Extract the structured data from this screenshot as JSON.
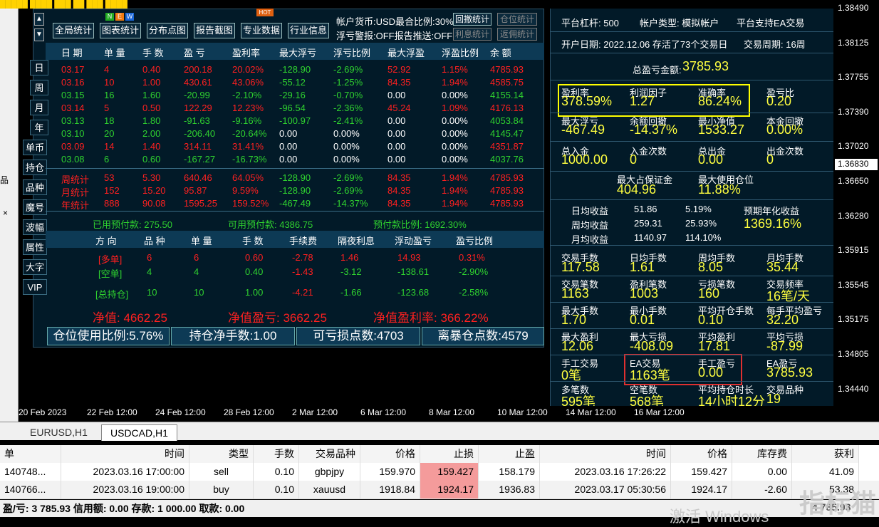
{
  "topbar": {
    "text": "█████ ████ ███ ██ ███ ████"
  },
  "left_strip": {
    "items": [
      "品",
      "×"
    ]
  },
  "price_axis": {
    "ticks": [
      "1.38490",
      "1.38125",
      "1.37755",
      "1.37390",
      "1.37020",
      "1.36650",
      "1.36280",
      "1.35915",
      "1.35545",
      "1.35175",
      "1.34805",
      "1.34440"
    ],
    "current": "1.36830"
  },
  "time_axis": {
    "ticks": [
      "20 Feb 2023",
      "22 Feb 12:00",
      "24 Feb 12:00",
      "28 Feb 12:00",
      "2 Mar 12:00",
      "6 Mar 12:00",
      "8 Mar 12:00",
      "10 Mar 12:00",
      "14 Mar 12:00",
      "16 Mar 12:00"
    ]
  },
  "chart_tabs": {
    "items": [
      "EURUSD,H1",
      "USDCAD,H1"
    ],
    "active": "USDCAD,H1"
  },
  "panel": {
    "buttons": [
      "全局统计",
      "图表统计",
      "分布点图",
      "报告截图",
      "专业数据",
      "行业信息"
    ],
    "badges": {
      "new": [
        "N",
        "E",
        "W"
      ],
      "hot": "HOT"
    },
    "info_line1": "帐户货币:USD最合比例:30%",
    "info_line2": "浮亏警报:OFF报告推送:OFF",
    "right_buttons": [
      {
        "label": "回撤统计",
        "active": true
      },
      {
        "label": "仓位统计",
        "active": false
      },
      {
        "label": "利息统计",
        "active": false
      },
      {
        "label": "返佣统计",
        "active": false
      }
    ],
    "period_buttons": [
      "日",
      "周",
      "月",
      "年"
    ],
    "side_buttons": [
      "单币",
      "持仓",
      "品种",
      "魔号",
      "波幅",
      "属性",
      "大字",
      "VIP"
    ],
    "columns": [
      "日 期",
      "单 量",
      "手 数",
      "盈 亏",
      "盈利率",
      "最大浮亏",
      "浮亏比例",
      "最大浮盈",
      "浮盈比例",
      "余 额"
    ],
    "daily_rows": [
      {
        "d": "03.17",
        "n": "4",
        "lots": "0.40",
        "pl": "200.18",
        "rate": "20.02%",
        "mfl": "-128.90",
        "mflr": "-2.69%",
        "mfp": "52.92",
        "mfpr": "1.15%",
        "bal": "4785.93",
        "color": "red"
      },
      {
        "d": "03.16",
        "n": "10",
        "lots": "1.00",
        "pl": "430.61",
        "rate": "43.06%",
        "mfl": "-55.12",
        "mflr": "-1.25%",
        "mfp": "84.35",
        "mfpr": "1.94%",
        "bal": "4585.75",
        "color": "red"
      },
      {
        "d": "03.15",
        "n": "16",
        "lots": "1.60",
        "pl": "-20.99",
        "rate": "-2.10%",
        "mfl": "-29.16",
        "mflr": "-0.70%",
        "mfp": "0.00",
        "mfpr": "0.00%",
        "bal": "4155.14",
        "color": "green"
      },
      {
        "d": "03.14",
        "n": "5",
        "lots": "0.50",
        "pl": "122.29",
        "rate": "12.23%",
        "mfl": "-96.54",
        "mflr": "-2.36%",
        "mfp": "45.24",
        "mfpr": "1.09%",
        "bal": "4176.13",
        "color": "red"
      },
      {
        "d": "03.13",
        "n": "18",
        "lots": "1.80",
        "pl": "-91.63",
        "rate": "-9.16%",
        "mfl": "-100.97",
        "mflr": "-2.41%",
        "mfp": "0.00",
        "mfpr": "0.00%",
        "bal": "4053.84",
        "color": "green"
      },
      {
        "d": "03.10",
        "n": "20",
        "lots": "2.00",
        "pl": "-206.40",
        "rate": "-20.64%",
        "mfl": "0.00",
        "mflr": "0.00%",
        "mfp": "0.00",
        "mfpr": "0.00%",
        "bal": "4145.47",
        "color": "green"
      },
      {
        "d": "03.09",
        "n": "14",
        "lots": "1.40",
        "pl": "314.11",
        "rate": "31.41%",
        "mfl": "0.00",
        "mflr": "0.00%",
        "mfp": "0.00",
        "mfpr": "0.00%",
        "bal": "4351.87",
        "color": "red"
      },
      {
        "d": "03.08",
        "n": "6",
        "lots": "0.60",
        "pl": "-167.27",
        "rate": "-16.73%",
        "mfl": "0.00",
        "mflr": "0.00%",
        "mfp": "0.00",
        "mfpr": "0.00%",
        "bal": "4037.76",
        "color": "green"
      }
    ],
    "summary_rows": [
      {
        "d": "周统计",
        "n": "53",
        "lots": "5.30",
        "pl": "640.46",
        "rate": "64.05%",
        "mfl": "-128.90",
        "mflr": "-2.69%",
        "mfp": "84.35",
        "mfpr": "1.94%",
        "bal": "4785.93"
      },
      {
        "d": "月统计",
        "n": "152",
        "lots": "15.20",
        "pl": "95.87",
        "rate": "9.59%",
        "mfl": "-128.90",
        "mflr": "-2.69%",
        "mfp": "84.35",
        "mfpr": "1.94%",
        "bal": "4785.93"
      },
      {
        "d": "年统计",
        "n": "888",
        "lots": "90.08",
        "pl": "1595.25",
        "rate": "159.52%",
        "mfl": "-467.49",
        "mflr": "-14.37%",
        "mfp": "84.35",
        "mfpr": "1.94%",
        "bal": "4785.93"
      }
    ],
    "prepay": {
      "used": "已用预付款: 275.50",
      "avail": "可用预付款: 4386.75",
      "ratio": "预付款比例: 1692.30%"
    },
    "pos_columns": [
      "方 向",
      "品 种",
      "单 量",
      "手 数",
      "手续费",
      "隔夜利息",
      "浮动盈亏",
      "盈亏比例"
    ],
    "pos_rows": [
      {
        "dir": "[多单]",
        "sym": "6",
        "n": "6",
        "lots": "0.60",
        "fee": "-2.78",
        "swap": "1.46",
        "fl": "14.93",
        "flr": "0.31%",
        "color": "red"
      },
      {
        "dir": "[空单]",
        "sym": "4",
        "n": "4",
        "lots": "0.40",
        "fee": "-1.43",
        "swap": "-3.12",
        "fl": "-138.61",
        "flr": "-2.90%",
        "color": "green"
      },
      {
        "dir": "[总持仓]",
        "sym": "10",
        "n": "10",
        "lots": "1.00",
        "fee": "-4.21",
        "swap": "-1.66",
        "fl": "-123.68",
        "flr": "-2.58%",
        "color": "green"
      }
    ],
    "equity": {
      "nav": "净值: 4662.25",
      "nav_pl": "净值盈亏: 3662.25",
      "nav_rate": "净值盈利率: 366.22%"
    },
    "bottom_boxes": [
      "仓位使用比例:5.76%",
      "持仓净手数:1.00",
      "可亏损点数:4703",
      "离暴仓点数:4579"
    ]
  },
  "stats": {
    "leverage": "平台杠杆: 500",
    "acct_type": "帐户类型: 模拟帐户",
    "ea_support": "平台支持EA交易",
    "open_date": "开户日期: 2022.12.06 存活了73个交易日",
    "trade_cycle": "交易周期: 16周",
    "total_pl_label": "总盈亏金额:",
    "total_pl": "3785.93",
    "grid": [
      [
        {
          "l": "盈利率",
          "v": "378.59%"
        },
        {
          "l": "利润因子",
          "v": "1.27"
        },
        {
          "l": "准确率",
          "v": "86.24%"
        },
        {
          "l": "盈亏比",
          "v": "0.20"
        }
      ],
      [
        {
          "l": "最大浮亏",
          "v": "-467.49"
        },
        {
          "l": "余额回撤",
          "v": "-14.37%"
        },
        {
          "l": "最小净值",
          "v": "1533.27"
        },
        {
          "l": "本金回撤",
          "v": "0.00%"
        }
      ],
      [
        {
          "l": "总入金",
          "v": "1000.00"
        },
        {
          "l": "入金次数",
          "v": "0"
        },
        {
          "l": "总出金",
          "v": "0.00"
        },
        {
          "l": "出金次数",
          "v": "0"
        }
      ]
    ],
    "margin": [
      {
        "l": "最大占保证金",
        "v": "404.96"
      },
      {
        "l": "最大使用仓位",
        "v": "11.88%"
      }
    ],
    "avg": [
      {
        "l": "日均收益",
        "v": "51.86",
        "p": "5.19%"
      },
      {
        "l": "周均收益",
        "v": "259.31",
        "p": "25.93%"
      },
      {
        "l": "月均收益",
        "v": "1140.97",
        "p": "114.10%"
      }
    ],
    "annual_label": "预期年化收益",
    "annual": "1369.16%",
    "grid2": [
      [
        {
          "l": "交易手数",
          "v": "117.58"
        },
        {
          "l": "日均手数",
          "v": "1.61"
        },
        {
          "l": "周均手数",
          "v": "8.05"
        },
        {
          "l": "月均手数",
          "v": "35.44"
        }
      ],
      [
        {
          "l": "交易笔数",
          "v": "1163"
        },
        {
          "l": "盈利笔数",
          "v": "1003"
        },
        {
          "l": "亏损笔数",
          "v": "160"
        },
        {
          "l": "交易频率",
          "v": "16笔/天"
        }
      ],
      [
        {
          "l": "最大手数",
          "v": "1.70"
        },
        {
          "l": "最小手数",
          "v": "0.01"
        },
        {
          "l": "平均开仓手数",
          "v": "0.10"
        },
        {
          "l": "每手平均盈亏",
          "v": "32.20"
        }
      ],
      [
        {
          "l": "最大盈利",
          "v": "12.06"
        },
        {
          "l": "最大亏损",
          "v": "-408.09"
        },
        {
          "l": "平均盈利",
          "v": "17.81"
        },
        {
          "l": "平均亏损",
          "v": "-87.99"
        }
      ],
      [
        {
          "l": "手工交易",
          "v": "0笔"
        },
        {
          "l": "EA交易",
          "v": "1163笔"
        },
        {
          "l": "手工盈亏",
          "v": "0.00"
        },
        {
          "l": "EA盈亏",
          "v": "3785.93"
        }
      ],
      [
        {
          "l": "多笔数",
          "v": "595笔"
        },
        {
          "l": "空笔数",
          "v": "568笔"
        },
        {
          "l": "平均持仓时长",
          "v": "14小时12分"
        },
        {
          "l": "交易品种",
          "v": "19"
        }
      ]
    ]
  },
  "trade_table": {
    "columns": [
      "单",
      "时间",
      "类型",
      "手数",
      "交易品种",
      "价格",
      "止损",
      "止盈",
      "时间",
      "价格",
      "库存费",
      "获利"
    ],
    "rows": [
      [
        "140748...",
        "2023.03.16 17:00:00",
        "sell",
        "0.10",
        "gbpjpy",
        "159.970",
        "159.427",
        "158.179",
        "2023.03.16 17:26:22",
        "159.427",
        "0.00",
        "41.09"
      ],
      [
        "140766...",
        "2023.03.16 19:00:00",
        "buy",
        "0.10",
        "xauusd",
        "1918.84",
        "1924.17",
        "1936.83",
        "2023.03.17 05:30:56",
        "1924.17",
        "-2.60",
        "53.38"
      ]
    ]
  },
  "status_bar": "盈/亏: 3 785.93  信用额: 0.00  存款: 1 000.00  取款: 0.00",
  "status_right": "4 785.93",
  "watermark": "指标猫",
  "windows_watermark": "激活 Windows"
}
